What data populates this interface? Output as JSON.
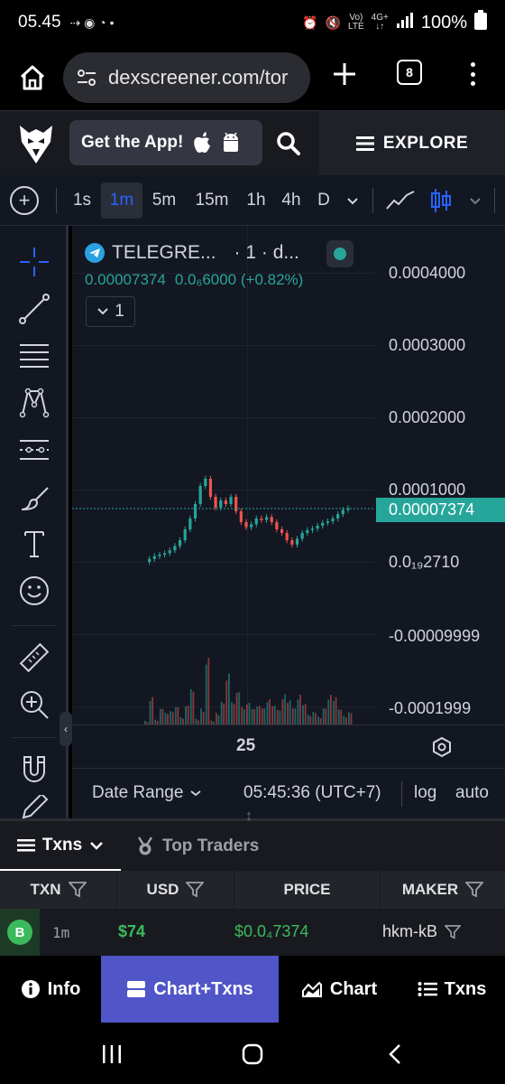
{
  "status": {
    "time": "05.45",
    "battery": "100%",
    "network": "4G+",
    "volte": "VoLTE"
  },
  "browser": {
    "url": "dexscreener.com/tor",
    "tab_count": "8"
  },
  "header": {
    "get_app_label": "Get the App!",
    "explore_label": "EXPLORE"
  },
  "toolbar": {
    "timeframes": [
      "1s",
      "1m",
      "5m",
      "15m",
      "1h",
      "4h",
      "D"
    ],
    "active_timeframe": "1m"
  },
  "legend": {
    "title": "TELEGRE...",
    "interval": "· 1 · d...",
    "price": "0.00007374",
    "change": "0.0₆6000 (+0.82%)",
    "collapse_count": "1"
  },
  "price_axis": {
    "labels": [
      "0.0004000",
      "0.0003000",
      "0.0002000",
      "0.0001000",
      "0.0₁₉2710",
      "-0.00009999",
      "-0.0001999"
    ],
    "current": "0.00007374"
  },
  "date_axis": {
    "label": "25"
  },
  "range_bar": {
    "date_range": "Date Range",
    "time": "05:45:36 (UTC+7)",
    "log": "log",
    "auto": "auto"
  },
  "txns_panel": {
    "txns_tab": "Txns",
    "top_traders_tab": "Top Traders",
    "columns": [
      "TXN",
      "USD",
      "PRICE",
      "MAKER"
    ],
    "rows": [
      {
        "type": "B",
        "age": "1m",
        "usd": "$74",
        "price": "$0.0₄7374",
        "maker": "hkm-kB"
      }
    ]
  },
  "bottom_nav": {
    "info": "Info",
    "chart_txns": "Chart+Txns",
    "chart": "Chart",
    "txns": "Txns"
  },
  "colors": {
    "up": "#26a69a",
    "down": "#ef5350",
    "active_tab": "#5055c8",
    "buy": "#3cba5b"
  },
  "chart_data": {
    "type": "candlestick",
    "x_label": "25",
    "y_ticks": [
      "0.0004000",
      "0.0003000",
      "0.0002000",
      "0.0001000",
      "0.0₁₉2710",
      "-0.00009999",
      "-0.0001999"
    ],
    "last_price": 7.374e-05,
    "series": [
      {
        "name": "price",
        "values": [
          0.0,
          4e-06,
          8e-06,
          1e-05,
          1.2e-05,
          1.6e-05,
          2.2e-05,
          3e-05,
          4.5e-05,
          6e-05,
          8e-05,
          0.000105,
          0.000115,
          9e-05,
          7.5e-05,
          8.5e-05,
          8e-05,
          9e-05,
          7e-05,
          5.5e-05,
          4.8e-05,
          5.2e-05,
          6e-05,
          5.8e-05,
          6.2e-05,
          5.5e-05,
          4.5e-05,
          4e-05,
          3e-05,
          2.4e-05,
          3.2e-05,
          4e-05,
          4.4e-05,
          4.6e-05,
          5e-05,
          5.4e-05,
          5.6e-05,
          6e-05,
          6.6e-05,
          7.2e-05,
          7.4e-05
        ]
      }
    ]
  }
}
